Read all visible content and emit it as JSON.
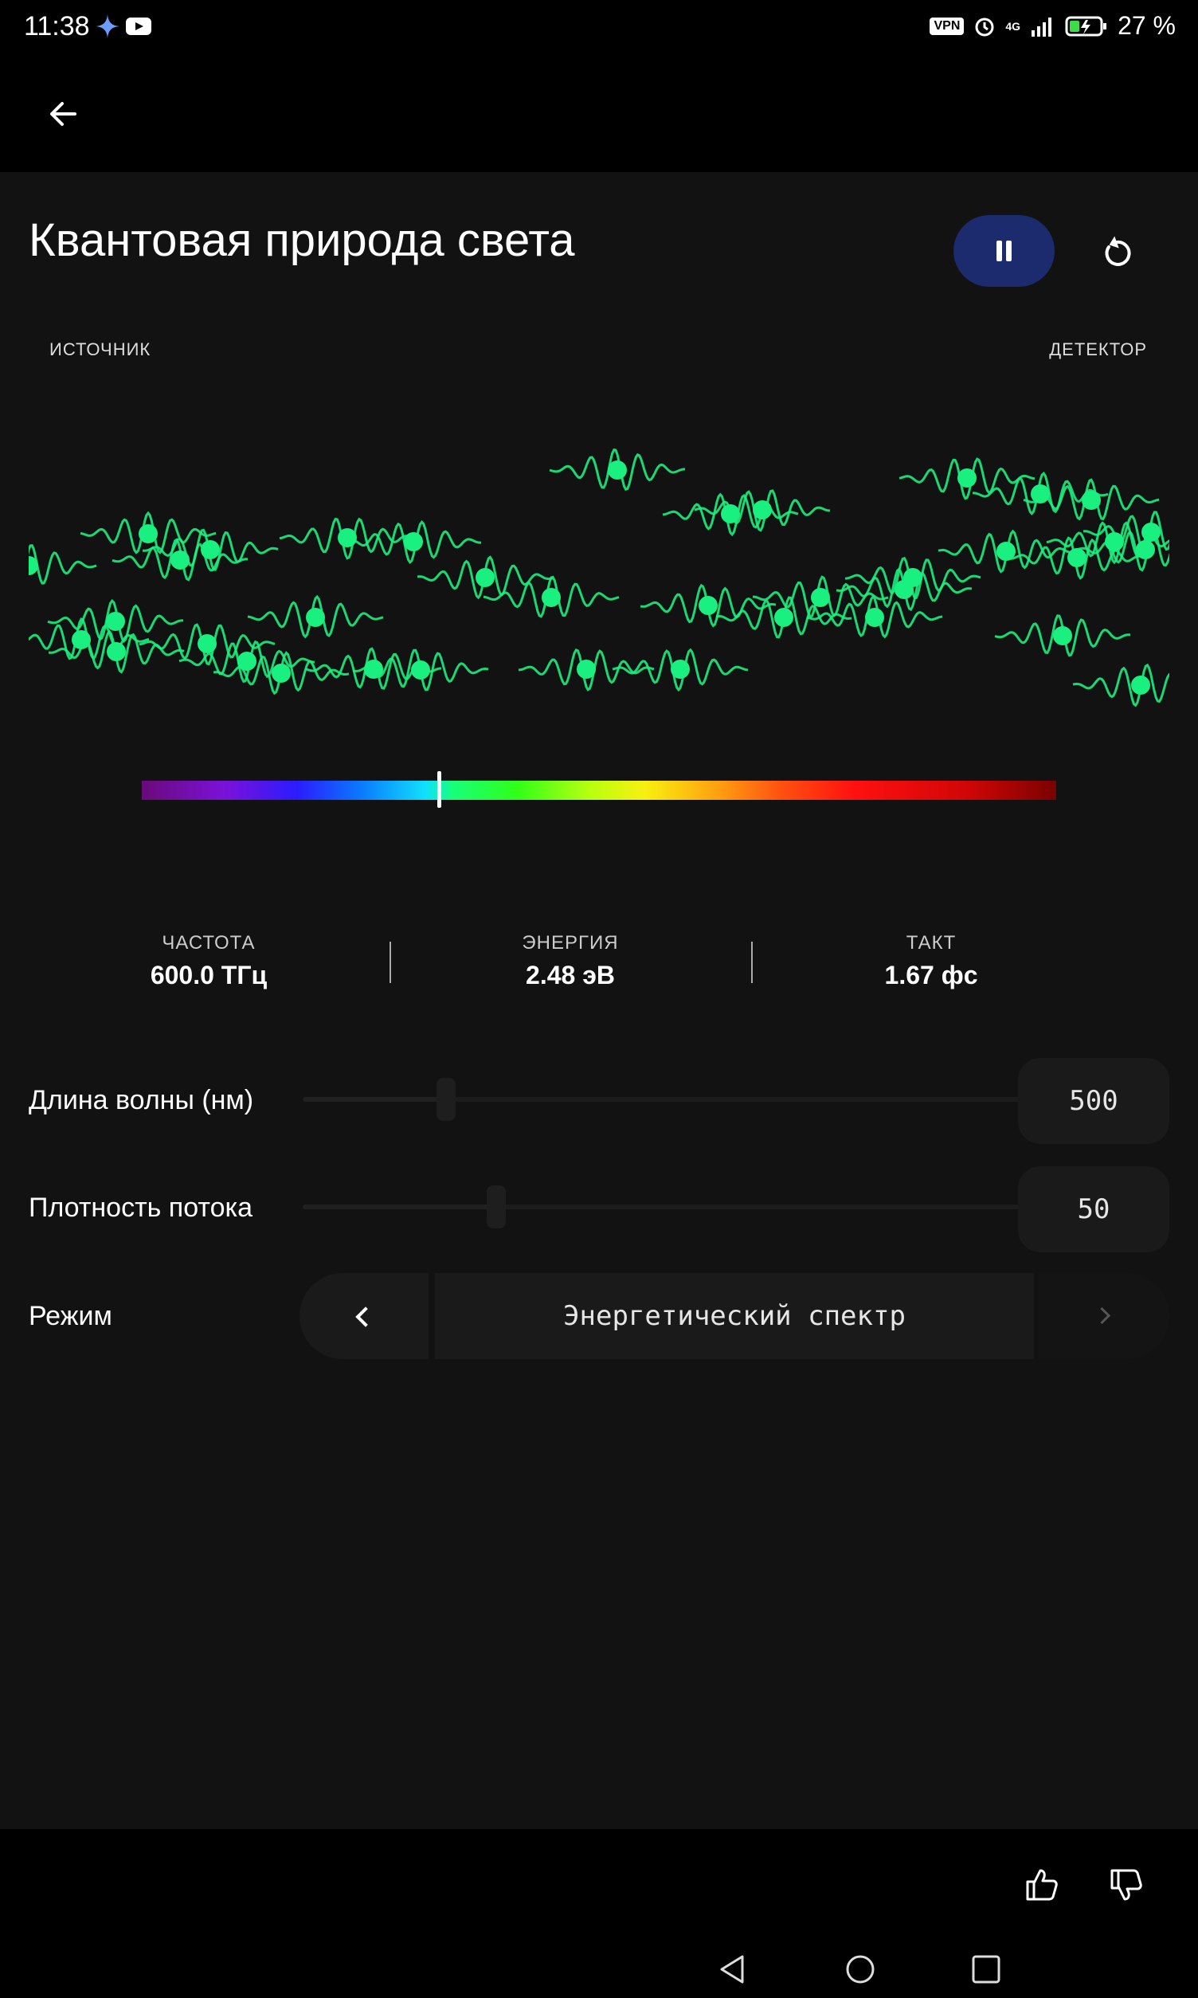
{
  "status_bar": {
    "time": "11:38",
    "vpn": "VPN",
    "network": "4G",
    "battery": "27 %"
  },
  "app_bar": {
    "back_icon": "arrow-left-icon"
  },
  "page": {
    "title": "Квантовая природа света",
    "play_state": "playing",
    "accent_color": "#1c2b6e",
    "photon_color": "#19f07f"
  },
  "simulation": {
    "source_label": "ИСТОЧНИК",
    "detector_label": "ДЕТЕКТОР",
    "spectrum_marker_fraction": 0.325
  },
  "stats": [
    {
      "label": "ЧАСТОТА",
      "value": "600.0 ТГц"
    },
    {
      "label": "ЭНЕРГИЯ",
      "value": "2.48 эВ"
    },
    {
      "label": "ТАКТ",
      "value": "1.67 фс"
    }
  ],
  "controls": {
    "wavelength": {
      "label": "Длина волны (нм)",
      "value": "500",
      "fraction": 0.2
    },
    "flux": {
      "label": "Плотность потока",
      "value": "50",
      "fraction": 0.27
    },
    "mode": {
      "label": "Режим",
      "value": "Энергетический спектр"
    }
  },
  "feedback": {
    "like_icon": "thumbs-up-icon",
    "dislike_icon": "thumbs-down-icon"
  },
  "nav_bar": {
    "back": "nav-back-icon",
    "home": "nav-home-icon",
    "recents": "nav-recents-icon"
  }
}
